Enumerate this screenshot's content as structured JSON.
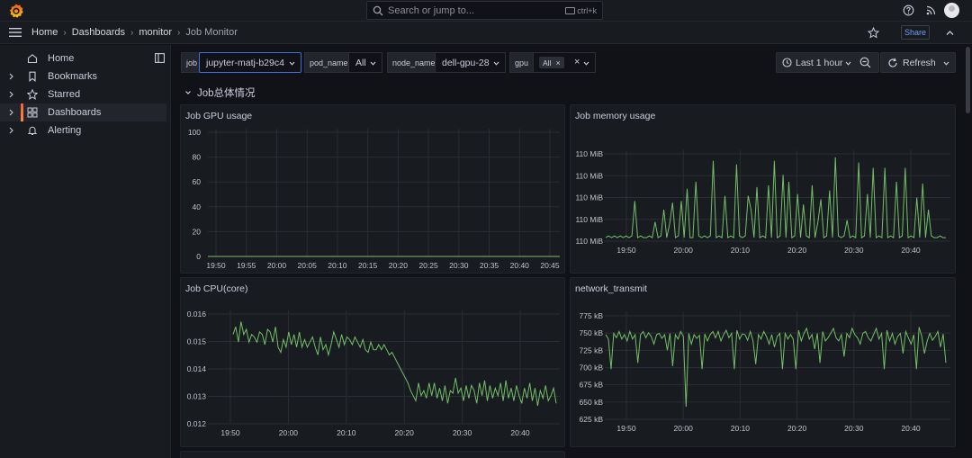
{
  "search": {
    "placeholder": "Search or jump to...",
    "shortcut": "ctrl+k"
  },
  "breadcrumb": [
    "Home",
    "Dashboards",
    "monitor",
    "Job Monitor"
  ],
  "toolbar": {
    "share_label": "Share"
  },
  "sidebar": {
    "items": [
      {
        "label": "Home",
        "icon": "home-icon"
      },
      {
        "label": "Bookmarks",
        "icon": "bookmark-icon"
      },
      {
        "label": "Starred",
        "icon": "star-icon"
      },
      {
        "label": "Dashboards",
        "icon": "dashboards-icon",
        "active": true
      },
      {
        "label": "Alerting",
        "icon": "bell-icon"
      }
    ]
  },
  "variables": {
    "job": {
      "label": "job",
      "value": "jupyter-matj-b29c4"
    },
    "pod_name": {
      "label": "pod_name",
      "value": "All"
    },
    "node_name": {
      "label": "node_name",
      "value": "dell-gpu-28"
    },
    "gpu": {
      "label": "gpu",
      "chip": "All"
    }
  },
  "time": {
    "range_label": "Last 1 hour",
    "refresh_label": "Refresh"
  },
  "row": {
    "title": "Job总体情况"
  },
  "colors": {
    "series": "#73bf69",
    "accent": "#ff8833",
    "link": "#6e9fff"
  },
  "chart_data": [
    {
      "type": "line",
      "title": "Job GPU usage",
      "ylim": [
        0,
        100
      ],
      "yticks": [
        "100",
        "80",
        "60",
        "40",
        "20",
        "0"
      ],
      "xticks": [
        "19:50",
        "19:55",
        "20:00",
        "20:05",
        "20:10",
        "20:15",
        "20:20",
        "20:25",
        "20:30",
        "20:35",
        "20:40",
        "20:45"
      ],
      "series": [
        {
          "values": [
            0,
            0,
            0,
            0,
            0,
            0,
            0,
            0,
            0,
            0,
            0,
            0
          ]
        }
      ]
    },
    {
      "type": "line",
      "title": "Job memory usage",
      "ylim": [
        0,
        5
      ],
      "yticks": [
        "110 MiB",
        "110 MiB",
        "110 MiB",
        "110 MiB",
        "110 MiB"
      ],
      "xticks": [
        "19:50",
        "20:00",
        "20:10",
        "20:20",
        "20:30",
        "20:40"
      ],
      "series": [
        {
          "values": [
            0.2,
            0.3,
            0.2,
            0.3,
            0.2,
            0.3,
            0.2,
            0.3,
            0.2,
            0.3,
            2.3,
            0.2,
            0.3,
            0.2,
            0.2,
            0.3,
            0.2,
            1.1,
            0.2,
            0.3,
            1.8,
            0.2,
            1.0,
            2.2,
            0.2,
            0.3,
            2.3,
            0.2,
            3.0,
            0.2,
            0.2,
            3.4,
            0.3,
            0.2,
            0.3,
            0.2,
            0.3,
            4.6,
            0.2,
            0.3,
            0.2,
            2.6,
            0.2,
            0.3,
            0.2,
            4.4,
            0.3,
            0.2,
            0.3,
            2.6,
            1.8,
            0.2,
            3.1,
            0.2,
            0.3,
            0.2,
            3.2,
            0.2,
            4.6,
            0.2,
            0.3,
            3.8,
            0.2,
            3.4,
            0.2,
            0.3,
            2.7,
            0.2,
            2.1,
            0.3,
            0.2,
            3.2,
            0.2,
            1.1,
            2.4,
            0.2,
            0.3,
            2.9,
            0.2,
            4.8,
            0.3,
            0.2,
            0.3,
            1.2,
            0.2,
            0.3,
            0.2,
            4.5,
            0.2,
            0.3,
            2.7,
            0.2,
            4.2,
            0.2,
            0.3,
            0.2,
            4.2,
            0.2,
            0.3,
            0.2,
            3.4,
            0.2,
            0.3,
            4.2,
            0.2,
            0.3,
            0.2,
            2.5,
            0.2,
            3.3,
            0.2,
            1.8,
            0.3,
            0.2,
            0.2,
            0.3,
            0.2,
            0.2
          ]
        }
      ]
    },
    {
      "type": "line",
      "title": "Job CPU(core)",
      "ylim": [
        0.012,
        0.0163
      ],
      "yticks": [
        "0.016",
        "0.015",
        "0.014",
        "0.013",
        "0.012"
      ],
      "xticks": [
        "19:50",
        "20:00",
        "20:10",
        "20:20",
        "20:30",
        "20:40"
      ],
      "series": [
        {
          "values": [
            0.0155,
            0.0158,
            0.0152,
            0.016,
            0.0155,
            0.0157,
            0.0152,
            0.0155,
            0.0154,
            0.0152,
            0.0156,
            0.0155,
            0.0151,
            0.0157,
            0.0156,
            0.0152,
            0.0158,
            0.015,
            0.0148,
            0.0153,
            0.015,
            0.0156,
            0.0151,
            0.0155,
            0.015,
            0.0156,
            0.015,
            0.0153,
            0.015,
            0.0152,
            0.0154,
            0.015,
            0.0147,
            0.0154,
            0.0149,
            0.0151,
            0.0147,
            0.0151,
            0.0156,
            0.0153,
            0.015,
            0.0155,
            0.0151,
            0.0154,
            0.0153,
            0.0151,
            0.0154,
            0.0152,
            0.015,
            0.0153,
            0.0149,
            0.0148,
            0.0152,
            0.0149,
            0.0149,
            0.0151,
            0.0149,
            0.0151,
            0.0149,
            0.0147,
            0.0148,
            0.0146,
            0.0144,
            0.0142,
            0.014,
            0.0138,
            0.0136,
            0.0133,
            0.0131,
            0.0129,
            0.0136,
            0.0131,
            0.0133,
            0.013,
            0.0136,
            0.0131,
            0.0136,
            0.013,
            0.0134,
            0.0129,
            0.0135,
            0.0128,
            0.0133,
            0.0132,
            0.0138,
            0.0132,
            0.0134,
            0.0129,
            0.0135,
            0.013,
            0.0135,
            0.0133,
            0.0128,
            0.0136,
            0.0131,
            0.0137,
            0.0129,
            0.0135,
            0.013,
            0.0134,
            0.0131,
            0.0136,
            0.0129,
            0.0137,
            0.013,
            0.0134,
            0.0129,
            0.0135,
            0.0131,
            0.0128,
            0.0134,
            0.013,
            0.0136,
            0.0129,
            0.0134,
            0.0127,
            0.0133,
            0.013,
            0.0135,
            0.0129,
            0.0131,
            0.0134,
            0.0128
          ]
        }
      ]
    },
    {
      "type": "line",
      "title": "network_transmit",
      "ylim": [
        620,
        785
      ],
      "yticks": [
        "775 kB",
        "750 kB",
        "725 kB",
        "700 kB",
        "675 kB",
        "650 kB",
        "625 kB"
      ],
      "xticks": [
        "19:50",
        "20:00",
        "20:10",
        "20:20",
        "20:30",
        "20:40"
      ],
      "series": [
        {
          "values": [
            755,
            748,
            700,
            757,
            750,
            760,
            748,
            755,
            745,
            760,
            748,
            755,
            710,
            755,
            760,
            750,
            758,
            752,
            740,
            755,
            757,
            749,
            755,
            730,
            757,
            705,
            755,
            748,
            760,
            752,
            640,
            757,
            740,
            755,
            749,
            754,
            700,
            756,
            745,
            755,
            760,
            750,
            760,
            745,
            755,
            762,
            750,
            757,
            700,
            762,
            748,
            756,
            755,
            746,
            760,
            745,
            708,
            755,
            748,
            760,
            752,
            740,
            755,
            735,
            752,
            757,
            700,
            757,
            748,
            755,
            748,
            700,
            762,
            745,
            757,
            765,
            748,
            755,
            732,
            757,
            710,
            760,
            745,
            750,
            757,
            765,
            750,
            745,
            755,
            720,
            757,
            750,
            765,
            755,
            750,
            740,
            757,
            760,
            750,
            745,
            755,
            765,
            748,
            757,
            700,
            762,
            745,
            757,
            740,
            752,
            757,
            725,
            760,
            750,
            740,
            755,
            700,
            767,
            752,
            725,
            745,
            757,
            746,
            752,
            760,
            735,
            756,
            710
          ]
        }
      ]
    }
  ]
}
